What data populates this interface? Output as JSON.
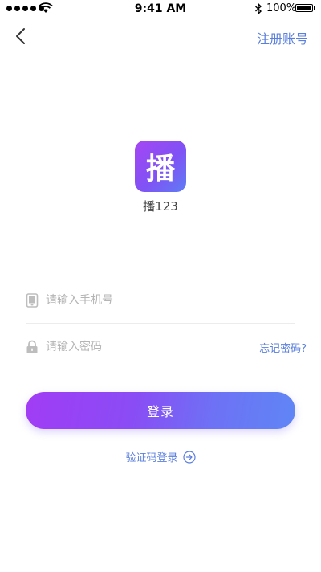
{
  "status_bar": {
    "time": "9:41 AM",
    "battery_percent": "100%",
    "signal_icon": "signal-dots-icon",
    "wifi_icon": "wifi-icon",
    "bluetooth_icon": "bluetooth-icon",
    "battery_icon": "battery-icon"
  },
  "nav": {
    "back_icon": "chevron-left-icon",
    "register_label": "注册账号"
  },
  "logo": {
    "glyph": "播",
    "app_name": "播123"
  },
  "form": {
    "phone": {
      "icon": "phone-icon",
      "placeholder": "请输入手机号",
      "value": ""
    },
    "password": {
      "icon": "lock-icon",
      "placeholder": "请输入密码",
      "value": "",
      "forgot_label": "忘记密码?"
    }
  },
  "login_button": {
    "label": "登录"
  },
  "sms_login": {
    "label": "验证码登录",
    "icon": "arrow-right-circle-icon"
  },
  "colors": {
    "accent": "#5b7fdc",
    "gradient_start": "#a13cf5",
    "gradient_end": "#5f86f5",
    "placeholder": "#b5b5b5",
    "divider": "#ececec"
  }
}
